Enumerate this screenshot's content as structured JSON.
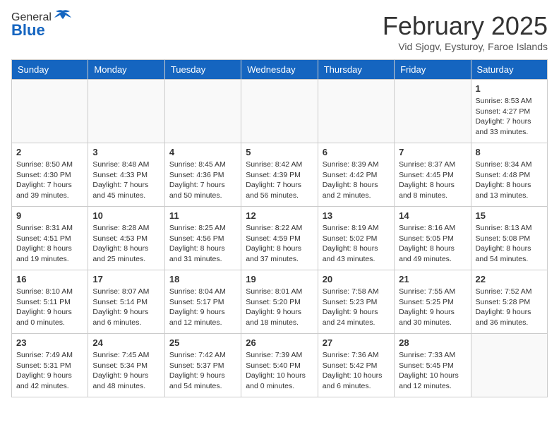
{
  "header": {
    "logo_general": "General",
    "logo_blue": "Blue",
    "month_title": "February 2025",
    "location": "Vid Sjogv, Eysturoy, Faroe Islands"
  },
  "weekdays": [
    "Sunday",
    "Monday",
    "Tuesday",
    "Wednesday",
    "Thursday",
    "Friday",
    "Saturday"
  ],
  "weeks": [
    [
      {
        "day": "",
        "info": ""
      },
      {
        "day": "",
        "info": ""
      },
      {
        "day": "",
        "info": ""
      },
      {
        "day": "",
        "info": ""
      },
      {
        "day": "",
        "info": ""
      },
      {
        "day": "",
        "info": ""
      },
      {
        "day": "1",
        "info": "Sunrise: 8:53 AM\nSunset: 4:27 PM\nDaylight: 7 hours and 33 minutes."
      }
    ],
    [
      {
        "day": "2",
        "info": "Sunrise: 8:50 AM\nSunset: 4:30 PM\nDaylight: 7 hours and 39 minutes."
      },
      {
        "day": "3",
        "info": "Sunrise: 8:48 AM\nSunset: 4:33 PM\nDaylight: 7 hours and 45 minutes."
      },
      {
        "day": "4",
        "info": "Sunrise: 8:45 AM\nSunset: 4:36 PM\nDaylight: 7 hours and 50 minutes."
      },
      {
        "day": "5",
        "info": "Sunrise: 8:42 AM\nSunset: 4:39 PM\nDaylight: 7 hours and 56 minutes."
      },
      {
        "day": "6",
        "info": "Sunrise: 8:39 AM\nSunset: 4:42 PM\nDaylight: 8 hours and 2 minutes."
      },
      {
        "day": "7",
        "info": "Sunrise: 8:37 AM\nSunset: 4:45 PM\nDaylight: 8 hours and 8 minutes."
      },
      {
        "day": "8",
        "info": "Sunrise: 8:34 AM\nSunset: 4:48 PM\nDaylight: 8 hours and 13 minutes."
      }
    ],
    [
      {
        "day": "9",
        "info": "Sunrise: 8:31 AM\nSunset: 4:51 PM\nDaylight: 8 hours and 19 minutes."
      },
      {
        "day": "10",
        "info": "Sunrise: 8:28 AM\nSunset: 4:53 PM\nDaylight: 8 hours and 25 minutes."
      },
      {
        "day": "11",
        "info": "Sunrise: 8:25 AM\nSunset: 4:56 PM\nDaylight: 8 hours and 31 minutes."
      },
      {
        "day": "12",
        "info": "Sunrise: 8:22 AM\nSunset: 4:59 PM\nDaylight: 8 hours and 37 minutes."
      },
      {
        "day": "13",
        "info": "Sunrise: 8:19 AM\nSunset: 5:02 PM\nDaylight: 8 hours and 43 minutes."
      },
      {
        "day": "14",
        "info": "Sunrise: 8:16 AM\nSunset: 5:05 PM\nDaylight: 8 hours and 49 minutes."
      },
      {
        "day": "15",
        "info": "Sunrise: 8:13 AM\nSunset: 5:08 PM\nDaylight: 8 hours and 54 minutes."
      }
    ],
    [
      {
        "day": "16",
        "info": "Sunrise: 8:10 AM\nSunset: 5:11 PM\nDaylight: 9 hours and 0 minutes."
      },
      {
        "day": "17",
        "info": "Sunrise: 8:07 AM\nSunset: 5:14 PM\nDaylight: 9 hours and 6 minutes."
      },
      {
        "day": "18",
        "info": "Sunrise: 8:04 AM\nSunset: 5:17 PM\nDaylight: 9 hours and 12 minutes."
      },
      {
        "day": "19",
        "info": "Sunrise: 8:01 AM\nSunset: 5:20 PM\nDaylight: 9 hours and 18 minutes."
      },
      {
        "day": "20",
        "info": "Sunrise: 7:58 AM\nSunset: 5:23 PM\nDaylight: 9 hours and 24 minutes."
      },
      {
        "day": "21",
        "info": "Sunrise: 7:55 AM\nSunset: 5:25 PM\nDaylight: 9 hours and 30 minutes."
      },
      {
        "day": "22",
        "info": "Sunrise: 7:52 AM\nSunset: 5:28 PM\nDaylight: 9 hours and 36 minutes."
      }
    ],
    [
      {
        "day": "23",
        "info": "Sunrise: 7:49 AM\nSunset: 5:31 PM\nDaylight: 9 hours and 42 minutes."
      },
      {
        "day": "24",
        "info": "Sunrise: 7:45 AM\nSunset: 5:34 PM\nDaylight: 9 hours and 48 minutes."
      },
      {
        "day": "25",
        "info": "Sunrise: 7:42 AM\nSunset: 5:37 PM\nDaylight: 9 hours and 54 minutes."
      },
      {
        "day": "26",
        "info": "Sunrise: 7:39 AM\nSunset: 5:40 PM\nDaylight: 10 hours and 0 minutes."
      },
      {
        "day": "27",
        "info": "Sunrise: 7:36 AM\nSunset: 5:42 PM\nDaylight: 10 hours and 6 minutes."
      },
      {
        "day": "28",
        "info": "Sunrise: 7:33 AM\nSunset: 5:45 PM\nDaylight: 10 hours and 12 minutes."
      },
      {
        "day": "",
        "info": ""
      }
    ]
  ]
}
